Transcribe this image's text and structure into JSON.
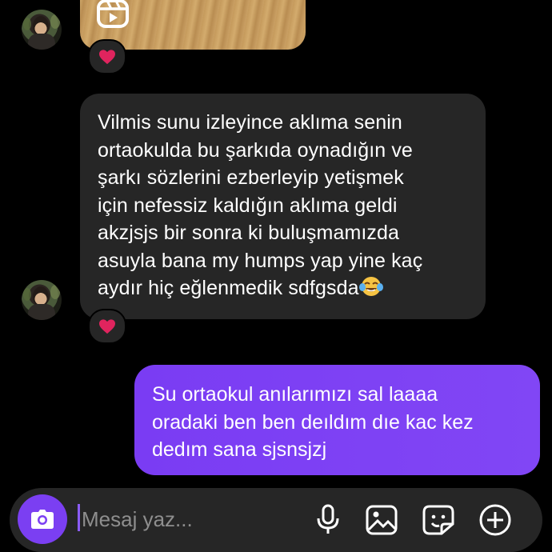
{
  "thread": {
    "incoming_message": "Vilmis sunu izleyince aklıma senin\nortaokulda bu şarkıda oynadığın ve\nşarkı sözlerini ezberleyip yetişmek\niçin nefessiz kaldığın aklıma geldi\nakzjsjs bir sonra ki buluşmamızda\nasuyla bana my humps yap yine kaç\naydır hiç eğlenmedik sdfgsda",
    "outgoing_message": "Su ortaokul anılarımızı sal laaaa\noradaki ben ben deıldım dıe kac kez\ndedım sana sjsnsjzj",
    "reactions": [
      "red-heart",
      "red-heart"
    ],
    "emoji_in_incoming": "face-with-tears-of-joy"
  },
  "composer": {
    "placeholder": "Mesaj yaz..."
  },
  "colors": {
    "background": "#000000",
    "incoming_bubble": "#262626",
    "outgoing_bubble": "#7b3ff2",
    "accent": "#7b3ff2",
    "heart": "#e0245e"
  },
  "icons": [
    "camera-icon",
    "microphone-icon",
    "gallery-icon",
    "sticker-icon",
    "plus-circle-icon",
    "reel-icon",
    "heart-icon"
  ]
}
